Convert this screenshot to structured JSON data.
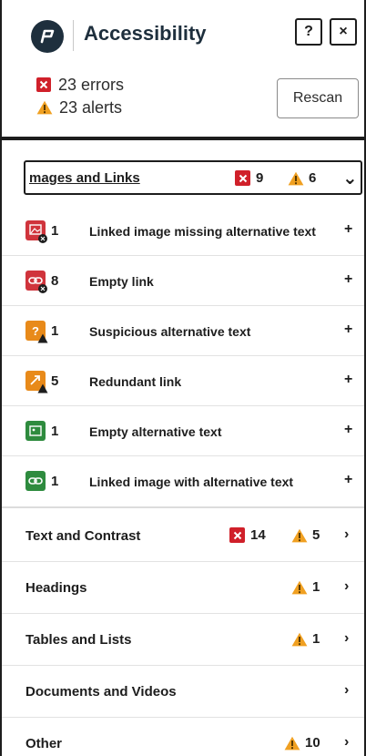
{
  "header": {
    "title": "Accessibility",
    "help_label": "?",
    "close_label": "×",
    "errors_text": "23 errors",
    "alerts_text": "23 alerts",
    "rescan_label": "Rescan"
  },
  "open_category": {
    "label": "mages and Links",
    "errors": "9",
    "alerts": "6",
    "chevron": "⌄"
  },
  "issues": [
    {
      "count": "1",
      "name": "Linked image missing alternative text",
      "action": "+",
      "thumb_color": "#d0343c",
      "marker": "error"
    },
    {
      "count": "8",
      "name": "Empty link",
      "action": "+",
      "thumb_color": "#d0343c",
      "marker": "error"
    },
    {
      "count": "1",
      "name": "Suspicious alternative text",
      "action": "+",
      "thumb_color": "#e88a1a",
      "marker": "alert"
    },
    {
      "count": "5",
      "name": "Redundant link",
      "action": "+",
      "thumb_color": "#e88a1a",
      "marker": "alert"
    },
    {
      "count": "1",
      "name": "Empty alternative text",
      "action": "+",
      "thumb_color": "#2e8b3e",
      "marker": "none"
    },
    {
      "count": "1",
      "name": "Linked image with alternative text",
      "action": "+",
      "thumb_color": "#2e8b3e",
      "marker": "none"
    }
  ],
  "categories": [
    {
      "label": "Text and Contrast",
      "errors": "14",
      "alerts": "5",
      "chevron": "›"
    },
    {
      "label": "Headings",
      "errors": "",
      "alerts": "1",
      "chevron": "›"
    },
    {
      "label": "Tables and Lists",
      "errors": "",
      "alerts": "1",
      "chevron": "›"
    },
    {
      "label": "Documents and Videos",
      "errors": "",
      "alerts": "",
      "chevron": "›"
    },
    {
      "label": "Other",
      "errors": "",
      "alerts": "10",
      "chevron": "›"
    }
  ],
  "colors": {
    "error": "#d0202a",
    "alert": "#f0a021",
    "brand": "#1e2f3d"
  },
  "icons": {
    "logo": "logo-icon",
    "help": "help-icon",
    "close": "close-icon",
    "error": "error-icon",
    "alert": "warning-icon"
  }
}
